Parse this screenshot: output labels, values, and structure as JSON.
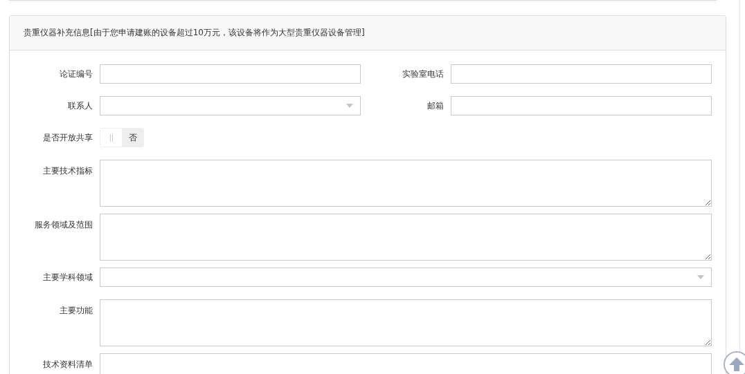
{
  "panel": {
    "title": "贵重仪器补充信息[由于您申请建账的设备超过10万元，该设备将作为大型贵重仪器设备管理]"
  },
  "rows": [
    {
      "fields": [
        {
          "kind": "text",
          "label": "论证编号"
        },
        {
          "kind": "text",
          "label": "实验室电话"
        }
      ]
    },
    {
      "fields": [
        {
          "kind": "select",
          "label": "联系人"
        },
        {
          "kind": "text",
          "label": "邮箱"
        }
      ]
    },
    {
      "fields": [
        {
          "kind": "switch",
          "label": "是否开放共享",
          "on": false,
          "off_text": "否"
        }
      ]
    },
    {
      "fields": [
        {
          "kind": "textarea",
          "label": "主要技术指标"
        }
      ]
    },
    {
      "fields": [
        {
          "kind": "textarea",
          "label": "服务领域及范围"
        }
      ]
    },
    {
      "fields": [
        {
          "kind": "select",
          "label": "主要学科领域"
        }
      ]
    },
    {
      "fields": [
        {
          "kind": "textarea",
          "label": "主要功能"
        }
      ]
    },
    {
      "fields": [
        {
          "kind": "textarea",
          "label": "技术资料清单"
        }
      ]
    }
  ]
}
